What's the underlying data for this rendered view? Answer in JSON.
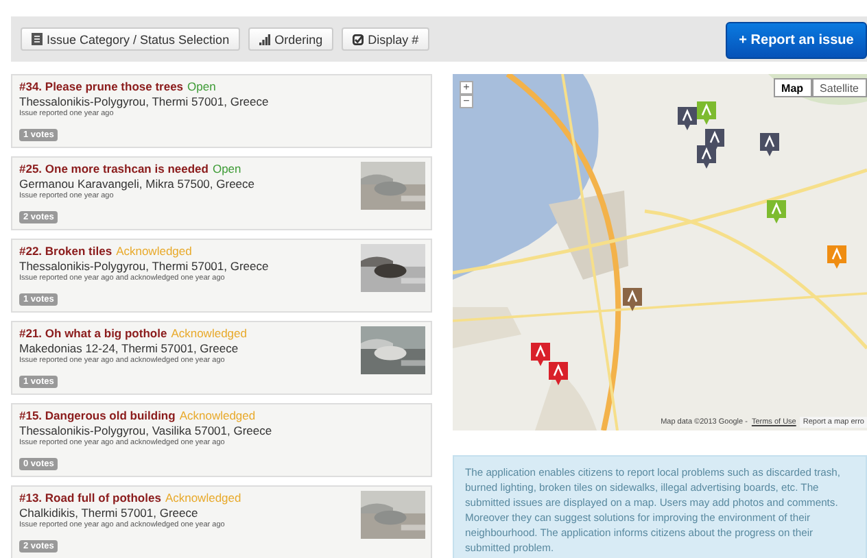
{
  "toolbar": {
    "filters": [
      {
        "kind": "category",
        "label": "Issue Category / Status Selection"
      },
      {
        "kind": "ordering",
        "label": "Ordering"
      },
      {
        "kind": "display",
        "label": "Display #"
      }
    ],
    "report_button": "+ Report an issue"
  },
  "issues": [
    {
      "title": "#34. Please prune those trees",
      "status": {
        "label": "Open",
        "color": "#3d9b35"
      },
      "address": "Thessalonikis-Polygyrou, Thermi 57001, Greece",
      "reported": "Issue reported one year ago",
      "votes": "1 votes",
      "photo": false
    },
    {
      "title": "#25. One more trashcan is needed",
      "status": {
        "label": "Open",
        "color": "#3d9b35"
      },
      "address": "Germanou Karavangeli, Mikra 57500, Greece",
      "reported": "Issue reported one year ago",
      "votes": "2 votes",
      "photo": true
    },
    {
      "title": "#22. Broken tiles",
      "status": {
        "label": "Acknowledged",
        "color": "#e8a92a"
      },
      "address": "Thessalonikis-Polygyrou, Thermi 57001, Greece",
      "reported": "Issue reported one year ago and acknowledged one year ago",
      "votes": "1 votes",
      "photo": true
    },
    {
      "title": "#21. Oh what a big pothole",
      "status": {
        "label": "Acknowledged",
        "color": "#e8a92a"
      },
      "address": "Makedonias 12-24, Thermi 57001, Greece",
      "reported": "Issue reported one year ago and acknowledged one year ago",
      "votes": "1 votes",
      "photo": true
    },
    {
      "title": "#15. Dangerous old building",
      "status": {
        "label": "Acknowledged",
        "color": "#e8a92a"
      },
      "address": "Thessalonikis-Polygyrou, Vasilika 57001, Greece",
      "reported": "Issue reported one year ago and acknowledged one year ago",
      "votes": "0 votes",
      "photo": false
    },
    {
      "title": "#13. Road full of potholes",
      "status": {
        "label": "Acknowledged",
        "color": "#e8a92a"
      },
      "address": "Chalkidikis, Thermi 57001, Greece",
      "reported": "Issue reported one year ago and acknowledged one year ago",
      "votes": "2 votes",
      "photo": true
    }
  ],
  "map": {
    "zoom_in": "+",
    "zoom_out": "−",
    "view_types": [
      {
        "label": "Map",
        "selected": true
      },
      {
        "label": "Satellite",
        "selected": false
      }
    ],
    "markers": [
      {
        "color": "#4a4e63"
      },
      {
        "color": "#7dbb2f"
      },
      {
        "color": "#4a4e63"
      },
      {
        "color": "#4a4e63"
      },
      {
        "color": "#4a4e63"
      },
      {
        "color": "#7dbb2f"
      },
      {
        "color": "#ef8d12"
      },
      {
        "color": "#8a6545"
      },
      {
        "color": "#d9202a"
      },
      {
        "color": "#d9202a"
      }
    ],
    "attribution": "Map data ©2013 Google -",
    "terms_link": "Terms of Use",
    "report_link": "Report a map erro"
  },
  "description": "The application enables citizens to report local problems such as discarded trash, burned lighting, broken tiles on sidewalks, illegal advertising boards, etc. The submitted issues are displayed on a map. Users may add photos and comments. Moreover they can suggest solutions for improving the environment of their neighbourhood. The application informs citizens about the progress on their submitted problem."
}
